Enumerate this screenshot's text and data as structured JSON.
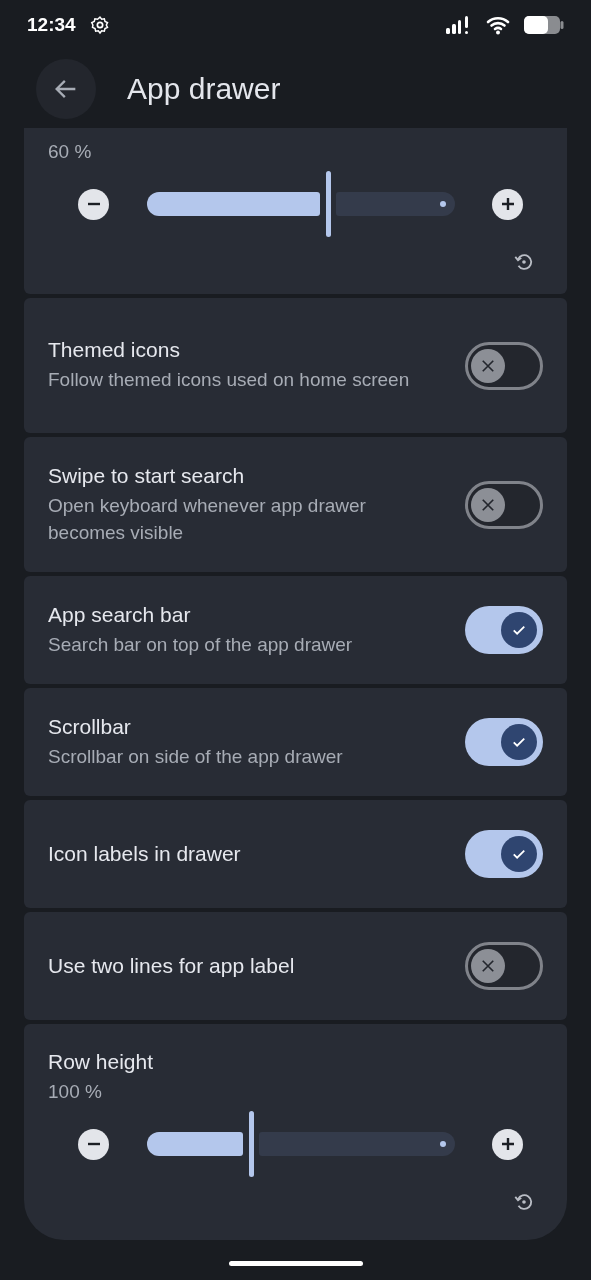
{
  "status_bar": {
    "time": "12:34"
  },
  "header": {
    "title": "App drawer"
  },
  "cards": [
    {
      "kind": "slider",
      "value": "60 %",
      "level": 0.59
    },
    {
      "kind": "toggle",
      "title": "Themed icons",
      "subtitle": "Follow themed icons used on home screen",
      "on": false
    },
    {
      "kind": "toggle",
      "title": "Swipe to start search",
      "subtitle": "Open keyboard whenever app drawer becomes visible",
      "on": false
    },
    {
      "kind": "toggle",
      "title": "App search bar",
      "subtitle": "Search bar on top of the app drawer",
      "on": true
    },
    {
      "kind": "toggle",
      "title": "Scrollbar",
      "subtitle": "Scrollbar on side of the app drawer",
      "on": true
    },
    {
      "kind": "toggle",
      "title": "Icon labels in drawer",
      "on": true
    },
    {
      "kind": "toggle",
      "title": "Use two lines for app label",
      "on": false
    },
    {
      "kind": "slider",
      "title": "Row height",
      "value": "100 %",
      "level": 0.34
    }
  ]
}
